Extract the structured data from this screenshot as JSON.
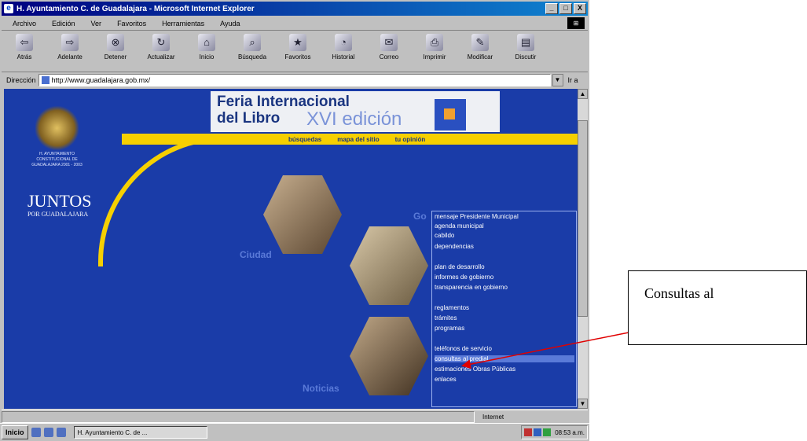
{
  "window": {
    "title": "H. Ayuntamiento C. de Guadalajara - Microsoft Internet Explorer",
    "controls": [
      "_",
      "□",
      "X"
    ]
  },
  "menubar": [
    "Archivo",
    "Edición",
    "Ver",
    "Favoritos",
    "Herramientas",
    "Ayuda"
  ],
  "toolbar": [
    {
      "label": "Atrás",
      "icon": "back-icon"
    },
    {
      "label": "Adelante",
      "icon": "forward-icon"
    },
    {
      "label": "Detener",
      "icon": "stop-icon"
    },
    {
      "label": "Actualizar",
      "icon": "refresh-icon"
    },
    {
      "label": "Inicio",
      "icon": "home-icon"
    },
    {
      "label": "Búsqueda",
      "icon": "search-icon"
    },
    {
      "label": "Favoritos",
      "icon": "favorites-icon"
    },
    {
      "label": "Historial",
      "icon": "history-icon"
    },
    {
      "label": "Correo",
      "icon": "mail-icon"
    },
    {
      "label": "Imprimir",
      "icon": "print-icon"
    },
    {
      "label": "Modificar",
      "icon": "edit-icon"
    },
    {
      "label": "Discutir",
      "icon": "discuss-icon"
    }
  ],
  "address": {
    "label": "Dirección",
    "url": "http://www.guadalajara.gob.mx/",
    "go": "Ir a"
  },
  "page": {
    "banner_line1": "Feria Internacional",
    "banner_line2": "del Libro",
    "banner_edition": "XVI edición",
    "nav_links": [
      "búsquedas",
      "mapa del sitio",
      "tu opinión"
    ],
    "crest_caption": "H. AYUNTAMIENTO CONSTITUCIONAL DE GUADALAJARA 2001 - 2003",
    "slogan": "JUNTOS",
    "slogan_sub": "POR GUADALAJARA",
    "sections": {
      "ciudad": "Ciudad",
      "gobierno": "Go",
      "noticias": "Noticias"
    },
    "menu_items": [
      {
        "label": "mensaje Presidente Municipal",
        "highlighted": false
      },
      {
        "label": "agenda municipal",
        "highlighted": false
      },
      {
        "label": "cabildo",
        "highlighted": false
      },
      {
        "label": "dependencias",
        "highlighted": false
      },
      {
        "label": "plan de desarrollo",
        "highlighted": false
      },
      {
        "label": "informes de gobierno",
        "highlighted": false
      },
      {
        "label": "transparencia en gobierno",
        "highlighted": false
      },
      {
        "label": "reglamentos",
        "highlighted": false
      },
      {
        "label": "trámites",
        "highlighted": false
      },
      {
        "label": "programas",
        "highlighted": false
      },
      {
        "label": "teléfonos de servicio",
        "highlighted": false
      },
      {
        "label": "consultas al predial",
        "highlighted": true
      },
      {
        "label": "estimaciones Obras Públicas",
        "highlighted": false
      },
      {
        "label": "enlaces",
        "highlighted": false
      }
    ]
  },
  "status": {
    "zone": "Internet"
  },
  "taskbar": {
    "start": "Inicio",
    "task": "H. Ayuntamiento C. de ...",
    "clock": "08:53 a.m."
  },
  "annotation": {
    "callout_text": "Consultas al",
    "arrow_color": "#e00000"
  }
}
